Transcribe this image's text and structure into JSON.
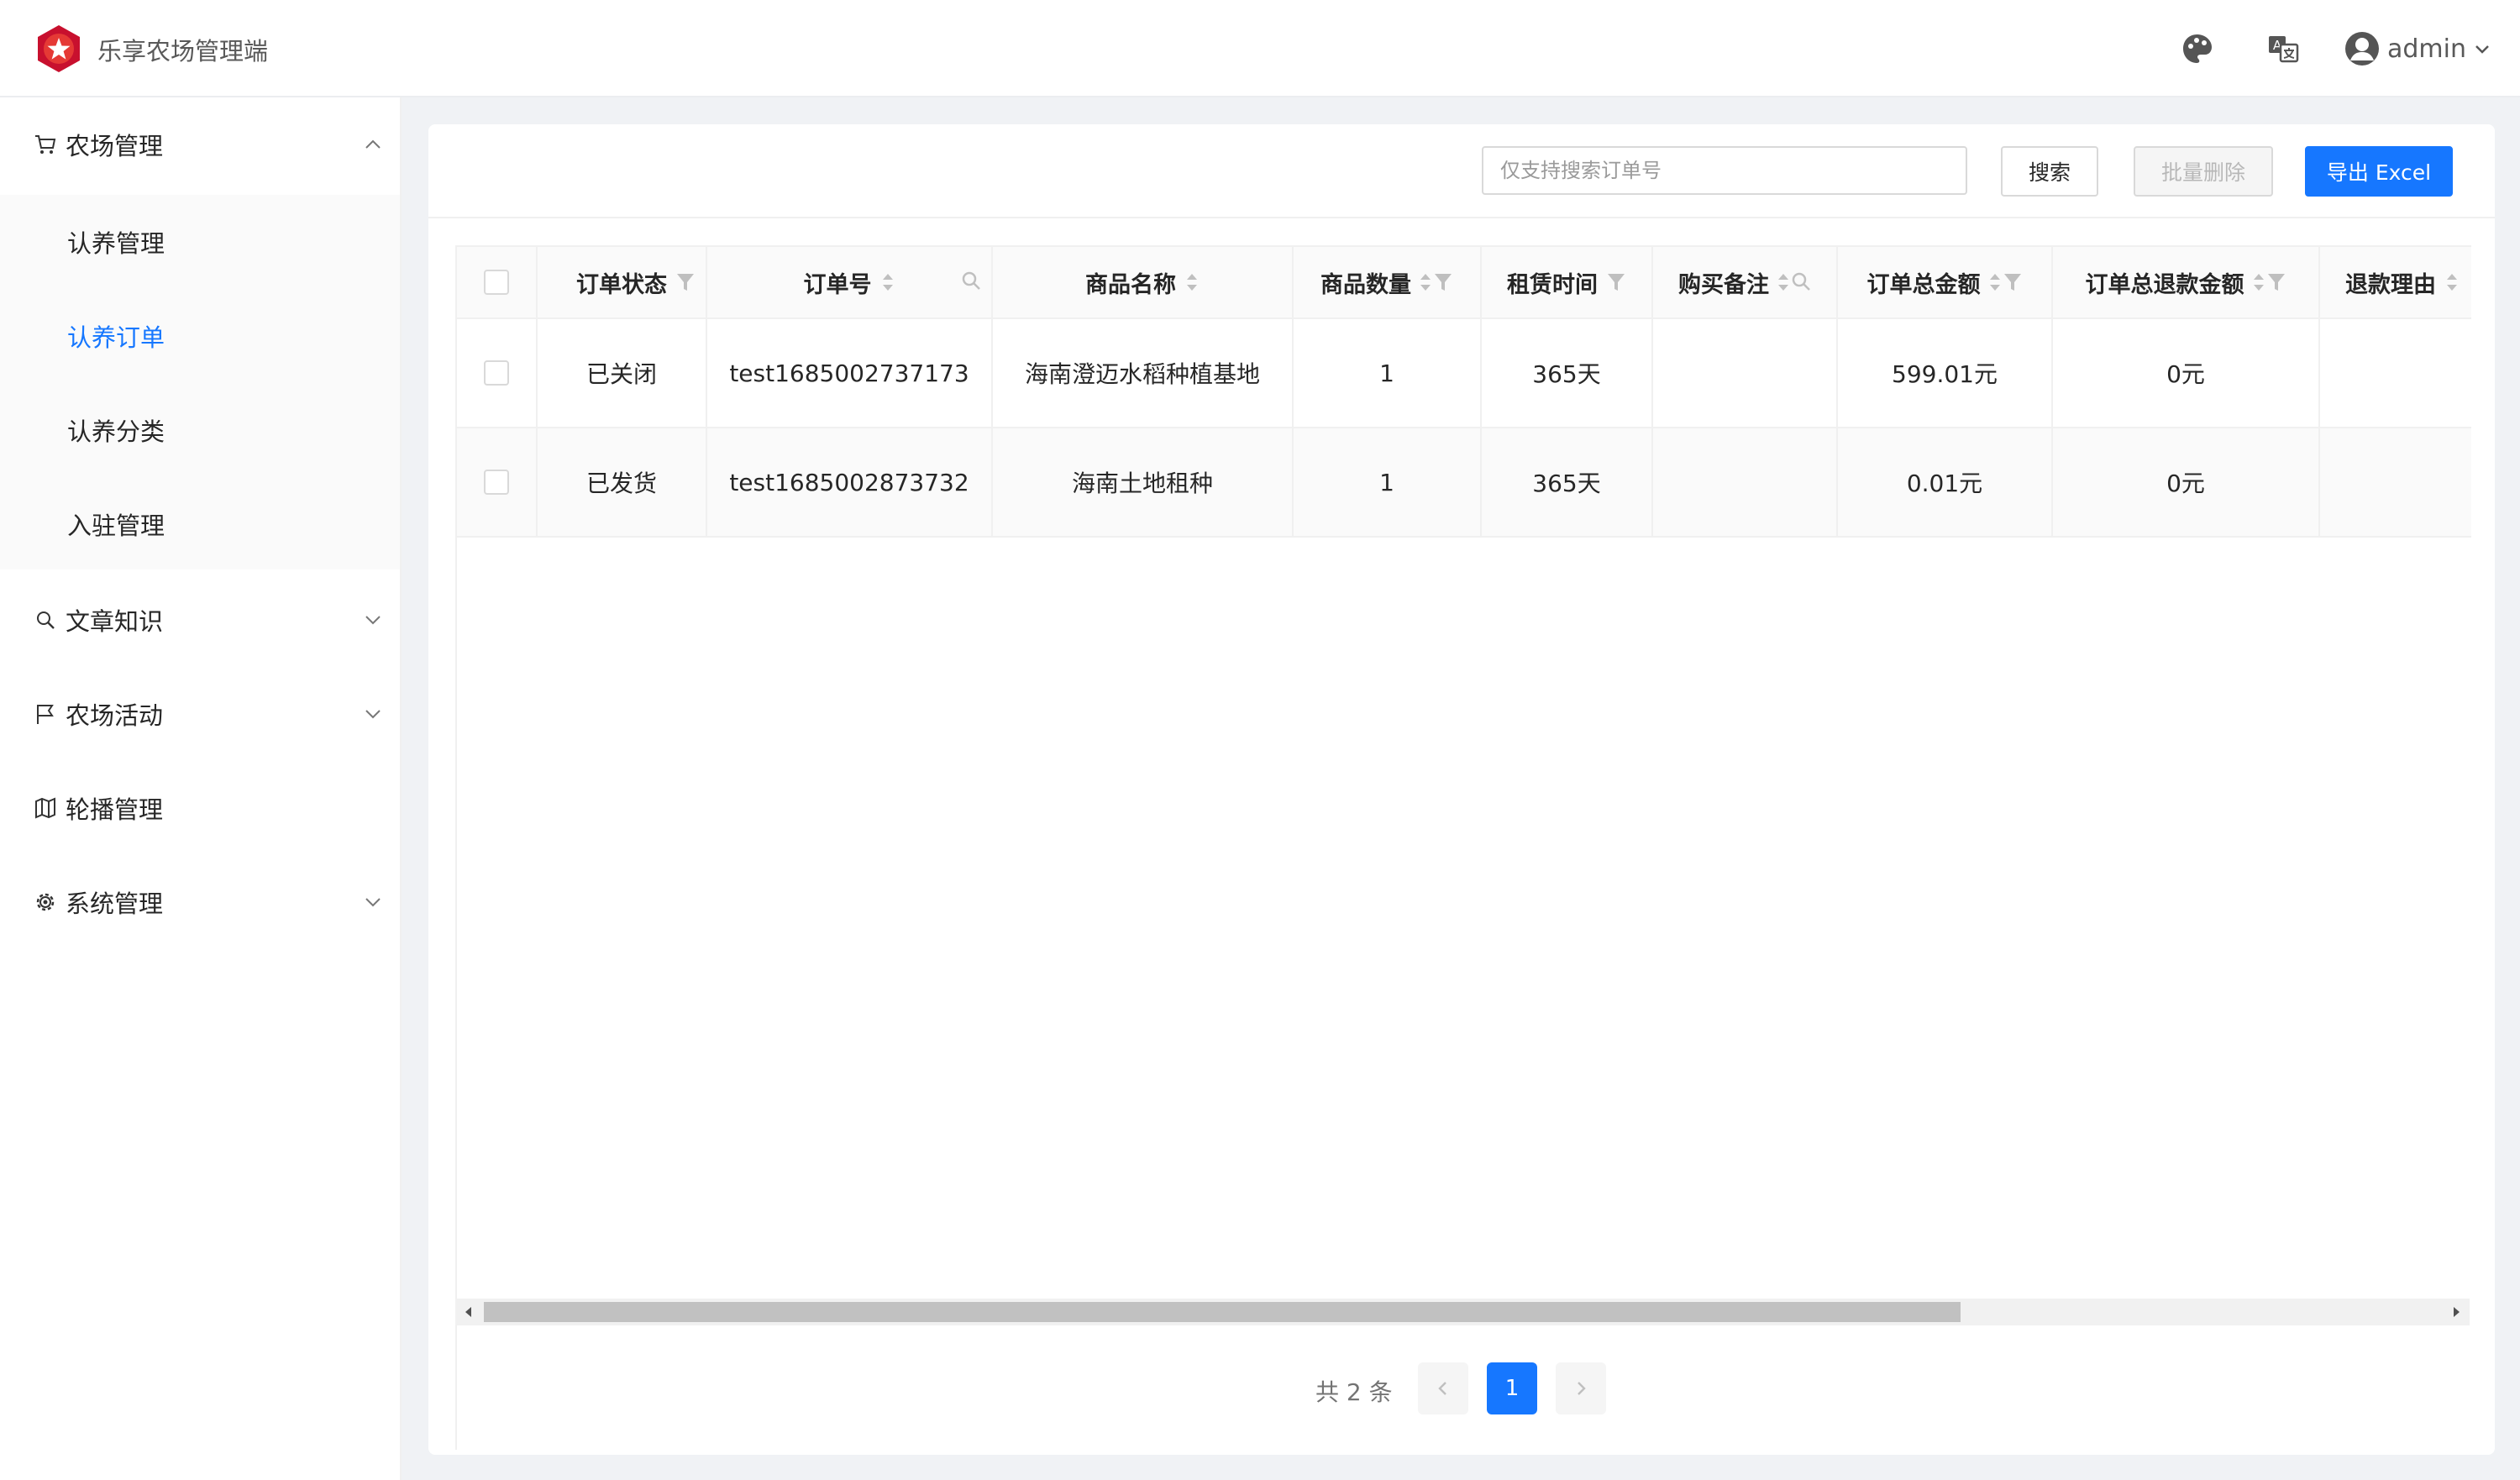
{
  "header": {
    "app_title": "乐享农场管理端",
    "username": "admin",
    "icons": [
      "logo-icon",
      "palette-icon",
      "translate-icon",
      "user-avatar-icon",
      "chevron-down-icon"
    ]
  },
  "sidebar": {
    "groups": [
      {
        "label": "农场管理",
        "icon": "cart-icon",
        "expanded": true,
        "children": [
          {
            "label": "认养管理",
            "active": false
          },
          {
            "label": "认养订单",
            "active": true
          },
          {
            "label": "认养分类",
            "active": false
          },
          {
            "label": "入驻管理",
            "active": false
          }
        ]
      },
      {
        "label": "文章知识",
        "icon": "search-icon",
        "expanded": false
      },
      {
        "label": "农场活动",
        "icon": "flag-icon",
        "expanded": false
      },
      {
        "label": "轮播管理",
        "icon": "map-icon"
      },
      {
        "label": "系统管理",
        "icon": "gear-icon",
        "expanded": false
      }
    ]
  },
  "toolbar": {
    "search_placeholder": "仅支持搜索订单号",
    "search_label": "搜索",
    "batch_delete_label": "批量删除",
    "export_label": "导出 Excel"
  },
  "table": {
    "columns": [
      {
        "label": "订单状态",
        "controls": [
          "filter"
        ]
      },
      {
        "label": "订单号",
        "controls": [
          "sort",
          "search"
        ]
      },
      {
        "label": "商品名称",
        "controls": [
          "sort"
        ]
      },
      {
        "label": "商品数量",
        "controls": [
          "sort",
          "filter"
        ]
      },
      {
        "label": "租赁时间",
        "controls": [
          "filter"
        ]
      },
      {
        "label": "购买备注",
        "controls": [
          "sort",
          "search"
        ]
      },
      {
        "label": "订单总金额",
        "controls": [
          "sort",
          "filter"
        ]
      },
      {
        "label": "订单总退款金额",
        "controls": [
          "sort",
          "filter"
        ]
      },
      {
        "label": "退款理由",
        "controls": [
          "sort"
        ]
      }
    ],
    "rows": [
      {
        "status": "已关闭",
        "order_no": "test1685002737173",
        "product": "海南澄迈水稻种植基地",
        "qty": "1",
        "lease": "365天",
        "note": "",
        "total": "599.01元",
        "refund": "0元",
        "reason": ""
      },
      {
        "status": "已发货",
        "order_no": "test1685002873732",
        "product": "海南土地租种",
        "qty": "1",
        "lease": "365天",
        "note": "",
        "total": "0.01元",
        "refund": "0元",
        "reason": ""
      }
    ]
  },
  "pagination": {
    "total_text": "共 2 条",
    "current_page": "1"
  },
  "colors": {
    "primary": "#1677ff",
    "logo_red": "#c8102e",
    "border": "#f0f0f0"
  }
}
